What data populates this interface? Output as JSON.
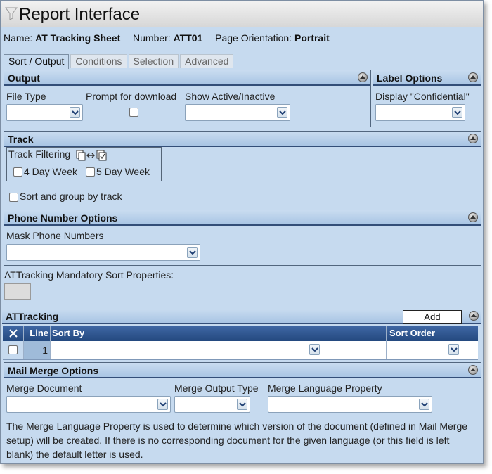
{
  "window": {
    "title": "Report Interface",
    "filter_icon": "funnel-icon"
  },
  "meta": {
    "name_label": "Name:",
    "name_value": "AT Tracking Sheet",
    "number_label": "Number:",
    "number_value": "ATT01",
    "orientation_label": "Page Orientation:",
    "orientation_value": "Portrait"
  },
  "tabs": [
    {
      "label": "Sort / Output",
      "active": true
    },
    {
      "label": "Conditions",
      "active": false
    },
    {
      "label": "Selection",
      "active": false
    },
    {
      "label": "Advanced",
      "active": false
    }
  ],
  "output": {
    "title": "Output",
    "file_type_label": "File Type",
    "file_type_value": "",
    "prompt_label": "Prompt for download",
    "prompt_checked": false,
    "show_active_label": "Show Active/Inactive",
    "show_active_value": ""
  },
  "label_options": {
    "title": "Label Options",
    "display_label": "Display \"Confidential\"",
    "display_value": ""
  },
  "track": {
    "title": "Track",
    "filtering_label": "Track Filtering",
    "four_day_label": "4 Day Week",
    "five_day_label": "5 Day Week",
    "sort_group_label": "Sort and group by track"
  },
  "phone": {
    "title": "Phone Number Options",
    "mask_label": "Mask Phone Numbers",
    "mask_value": ""
  },
  "mandatory": {
    "label": "ATTracking Mandatory Sort Properties:"
  },
  "attracking": {
    "title": "ATTracking",
    "add_label": "Add",
    "columns": {
      "line": "Line",
      "sort_by": "Sort By",
      "sort_order": "Sort Order"
    },
    "rows": [
      {
        "line": "1",
        "sort_by": "",
        "sort_order": ""
      }
    ]
  },
  "mail_merge": {
    "title": "Mail Merge Options",
    "merge_doc_label": "Merge Document",
    "merge_output_label": "Merge Output Type",
    "merge_lang_label": "Merge Language Property",
    "description": "The Merge Language Property is used to determine which version of the document (defined in Mail Merge setup) will be created. If there is no corresponding document for the given language (or this field is left blank) the default letter is used."
  },
  "colors": {
    "panel_bg": "#c6daef",
    "header_border": "#334e78",
    "grid_header": "#24497f"
  }
}
